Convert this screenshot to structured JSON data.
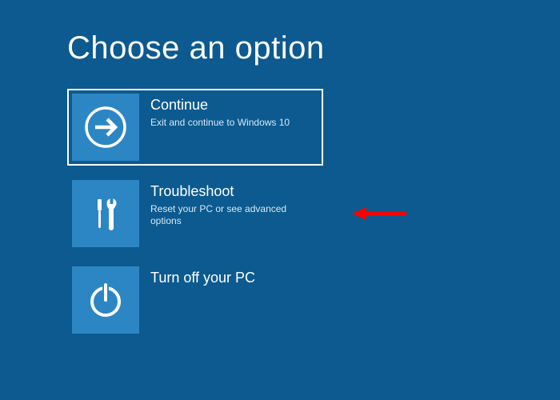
{
  "title": "Choose an option",
  "options": [
    {
      "title": "Continue",
      "desc": "Exit and continue to Windows 10",
      "icon": "arrow-right",
      "selected": true
    },
    {
      "title": "Troubleshoot",
      "desc": "Reset your PC or see advanced options",
      "icon": "tools",
      "selected": false
    },
    {
      "title": "Turn off your PC",
      "desc": "",
      "icon": "power",
      "selected": false
    }
  ],
  "annotation": {
    "type": "arrow",
    "color": "#ff0000",
    "target_option_index": 1
  }
}
